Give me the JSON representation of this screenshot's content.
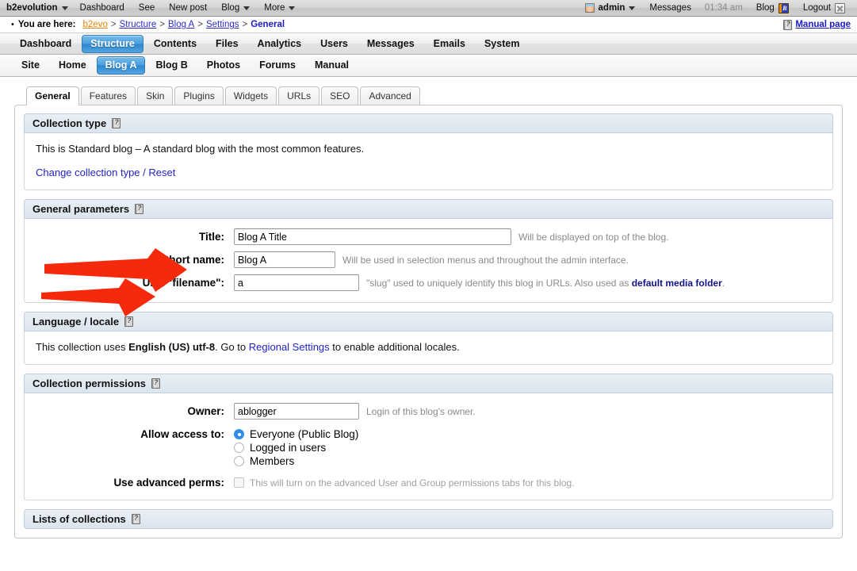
{
  "topbar": {
    "brand": "b2evolution",
    "left_items": [
      {
        "label": "Dashboard",
        "caret": false
      },
      {
        "label": "See",
        "caret": false
      },
      {
        "label": "New post",
        "caret": false
      },
      {
        "label": "Blog",
        "caret": true
      },
      {
        "label": "More",
        "caret": true
      }
    ],
    "user": "admin",
    "messages": "Messages",
    "time": "01:34 am",
    "blog": "Blog",
    "logout": "Logout"
  },
  "breadcrumb": {
    "lead": "You are here:",
    "items": [
      {
        "label": "b2evo",
        "style": "orange"
      },
      {
        "label": "Structure",
        "style": "link"
      },
      {
        "label": "Blog A",
        "style": "link"
      },
      {
        "label": "Settings",
        "style": "link"
      },
      {
        "label": "General",
        "style": "bold"
      }
    ],
    "separator": ">",
    "manual_label": "Manual page"
  },
  "main_nav": [
    {
      "label": "Dashboard",
      "active": false
    },
    {
      "label": "Structure",
      "active": true
    },
    {
      "label": "Contents",
      "active": false
    },
    {
      "label": "Files",
      "active": false
    },
    {
      "label": "Analytics",
      "active": false
    },
    {
      "label": "Users",
      "active": false
    },
    {
      "label": "Messages",
      "active": false
    },
    {
      "label": "Emails",
      "active": false
    },
    {
      "label": "System",
      "active": false
    }
  ],
  "sub_nav": [
    {
      "label": "Site",
      "active": false
    },
    {
      "label": "Home",
      "active": false
    },
    {
      "label": "Blog A",
      "active": true
    },
    {
      "label": "Blog B",
      "active": false
    },
    {
      "label": "Photos",
      "active": false
    },
    {
      "label": "Forums",
      "active": false
    },
    {
      "label": "Manual",
      "active": false
    }
  ],
  "tabs": [
    {
      "label": "General",
      "active": true
    },
    {
      "label": "Features",
      "active": false
    },
    {
      "label": "Skin",
      "active": false
    },
    {
      "label": "Plugins",
      "active": false
    },
    {
      "label": "Widgets",
      "active": false
    },
    {
      "label": "URLs",
      "active": false
    },
    {
      "label": "SEO",
      "active": false
    },
    {
      "label": "Advanced",
      "active": false
    }
  ],
  "collection_type": {
    "title": "Collection type",
    "description": "This is Standard blog – A standard blog with the most common features.",
    "change_link": "Change collection type / Reset"
  },
  "general_parameters": {
    "title": "General parameters",
    "title_label": "Title:",
    "title_value": "Blog A Title",
    "title_hint": "Will be displayed on top of the blog.",
    "shortname_label": "Short name:",
    "shortname_value": "Blog A",
    "shortname_hint": "Will be used in selection menus and throughout the admin interface.",
    "urlfilename_label": "URL \"filename\":",
    "urlfilename_value": "a",
    "urlfilename_hint_pre": "\"slug\" used to uniquely identify this blog in URLs. Also used as ",
    "urlfilename_hint_link": "default media folder",
    "urlfilename_hint_post": "."
  },
  "language_locale": {
    "title": "Language / locale",
    "text_pre": "This collection uses ",
    "locale": "English (US) utf-8",
    "text_mid": ". Go to ",
    "link": "Regional Settings",
    "text_post": " to enable additional locales."
  },
  "collection_permissions": {
    "title": "Collection permissions",
    "owner_label": "Owner:",
    "owner_value": "ablogger",
    "owner_hint": "Login of this blog's owner.",
    "access_label": "Allow access to:",
    "access_options": [
      {
        "label": "Everyone (Public Blog)",
        "selected": true
      },
      {
        "label": "Logged in users",
        "selected": false
      },
      {
        "label": "Members",
        "selected": false
      }
    ],
    "advanced_label": "Use advanced perms:",
    "advanced_hint": "This will turn on the advanced User and Group permissions tabs for this blog.",
    "advanced_checked": false
  },
  "lists_of_collections": {
    "title": "Lists of collections"
  },
  "annotations": {
    "arrow_color": "#f5290b",
    "arrows": [
      {
        "target": "title-field-row"
      },
      {
        "target": "short-name-field-row"
      }
    ]
  }
}
